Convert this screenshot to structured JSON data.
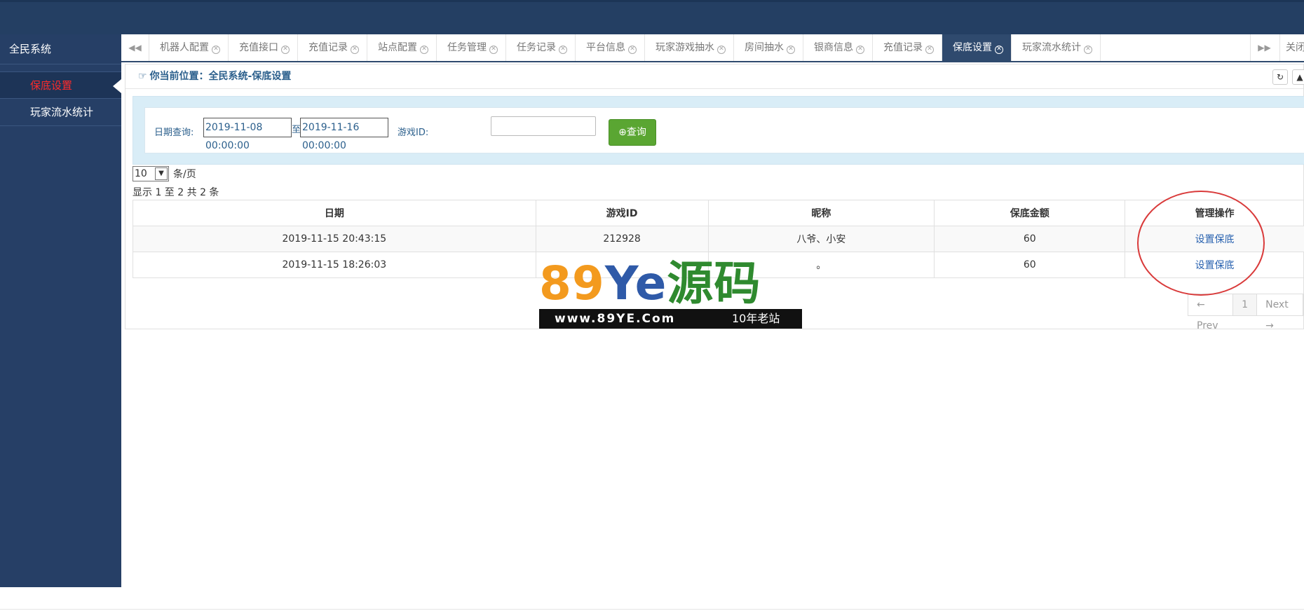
{
  "sidebar": {
    "title": "全民系统",
    "items": [
      {
        "label": "保底设置"
      },
      {
        "label": "玩家流水统计"
      }
    ]
  },
  "tabs": {
    "prev_icon": "double-chevron-left-icon",
    "next_icon": "double-chevron-right-icon",
    "items": [
      {
        "label": "机器人配置"
      },
      {
        "label": "充值接口"
      },
      {
        "label": "充值记录"
      },
      {
        "label": "站点配置"
      },
      {
        "label": "任务管理"
      },
      {
        "label": "任务记录"
      },
      {
        "label": "平台信息"
      },
      {
        "label": "玩家游戏抽水"
      },
      {
        "label": "房间抽水"
      },
      {
        "label": "银商信息"
      },
      {
        "label": "充值记录"
      },
      {
        "label": "保底设置"
      },
      {
        "label": "玩家流水统计"
      }
    ],
    "active_index": 11,
    "close_all": "关闭"
  },
  "breadcrumb": {
    "text": "你当前位置：全民系统-保底设置"
  },
  "filter": {
    "date_label": "日期查询:",
    "start": "2019-11-08 00:00:00",
    "sep": "至",
    "end": "2019-11-16 00:00:00",
    "id_label": "游戏ID:",
    "id_value": "",
    "query_button": "查询"
  },
  "page_size": {
    "value": "10",
    "suffix": "条/页"
  },
  "info": "显示 1 至 2 共 2 条",
  "table": {
    "columns": [
      "日期",
      "游戏ID",
      "昵称",
      "保底金额",
      "管理操作"
    ],
    "rows": [
      {
        "date": "2019-11-15 20:43:15",
        "game_id": "212928",
        "nickname": "八爷、小安",
        "amount": "60",
        "action": "设置保底"
      },
      {
        "date": "2019-11-15 18:26:03",
        "game_id": "",
        "nickname": "。",
        "amount": "60",
        "action": "设置保底"
      }
    ]
  },
  "pagination": {
    "prev": "← Prev",
    "current": "1",
    "next": "Next →"
  },
  "watermark": {
    "digits": "89",
    "letters": "Ye",
    "chars": "源码",
    "url": "www.89YE.Com",
    "tag": "10年老站"
  },
  "colors": {
    "sidebar_bg": "#263f66",
    "active_tab": "#2f4a6e",
    "active_side_text": "#ff2a2a",
    "query_button": "#5aa632",
    "annotation_circle": "#d93a3a"
  }
}
